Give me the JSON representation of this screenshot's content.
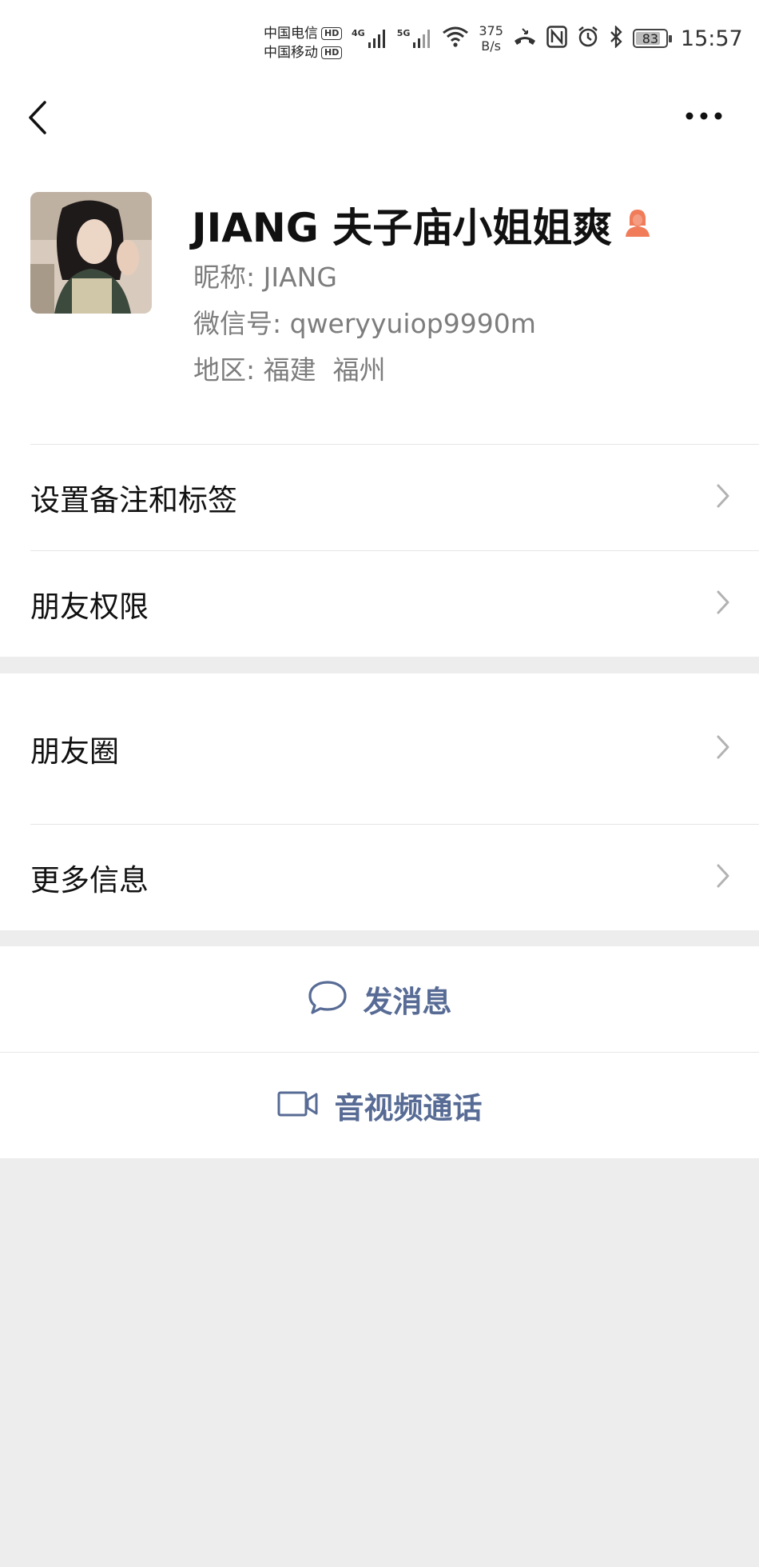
{
  "status_bar": {
    "carrier_1": "中国电信",
    "carrier_2": "中国移动",
    "hd_label": "HD",
    "network_1": "4G",
    "network_2": "5G",
    "net_speed_value": "375",
    "net_speed_unit": "B/s",
    "nfc_label": "N",
    "battery_level": 83,
    "battery_text": "83",
    "time": "15:57"
  },
  "header": {
    "back_icon": "chevron-left-icon",
    "more_icon": "more-dots-icon"
  },
  "profile": {
    "display_name": "JIANG 夫子庙小姐姐爽",
    "gender_icon": "female-icon",
    "gender_icon_color": "#f07c5a",
    "nickname_label": "昵称:",
    "nickname_value": "JIANG",
    "wechat_id_label": "微信号:",
    "wechat_id_value": "qweryyuiop9990m",
    "region_label": "地区:",
    "region_value": "福建  福州"
  },
  "menu_group_1": [
    {
      "label": "设置备注和标签"
    },
    {
      "label": "朋友权限"
    }
  ],
  "menu_group_2": [
    {
      "label": "朋友圈"
    },
    {
      "label": "更多信息"
    }
  ],
  "actions": {
    "send_message_label": "发消息",
    "send_message_icon": "chat-bubble-icon",
    "video_call_label": "音视频通话",
    "video_call_icon": "video-camera-icon"
  },
  "colors": {
    "link_blue": "#576b95",
    "background": "#ededed",
    "chevron": "#b2b2b2"
  }
}
